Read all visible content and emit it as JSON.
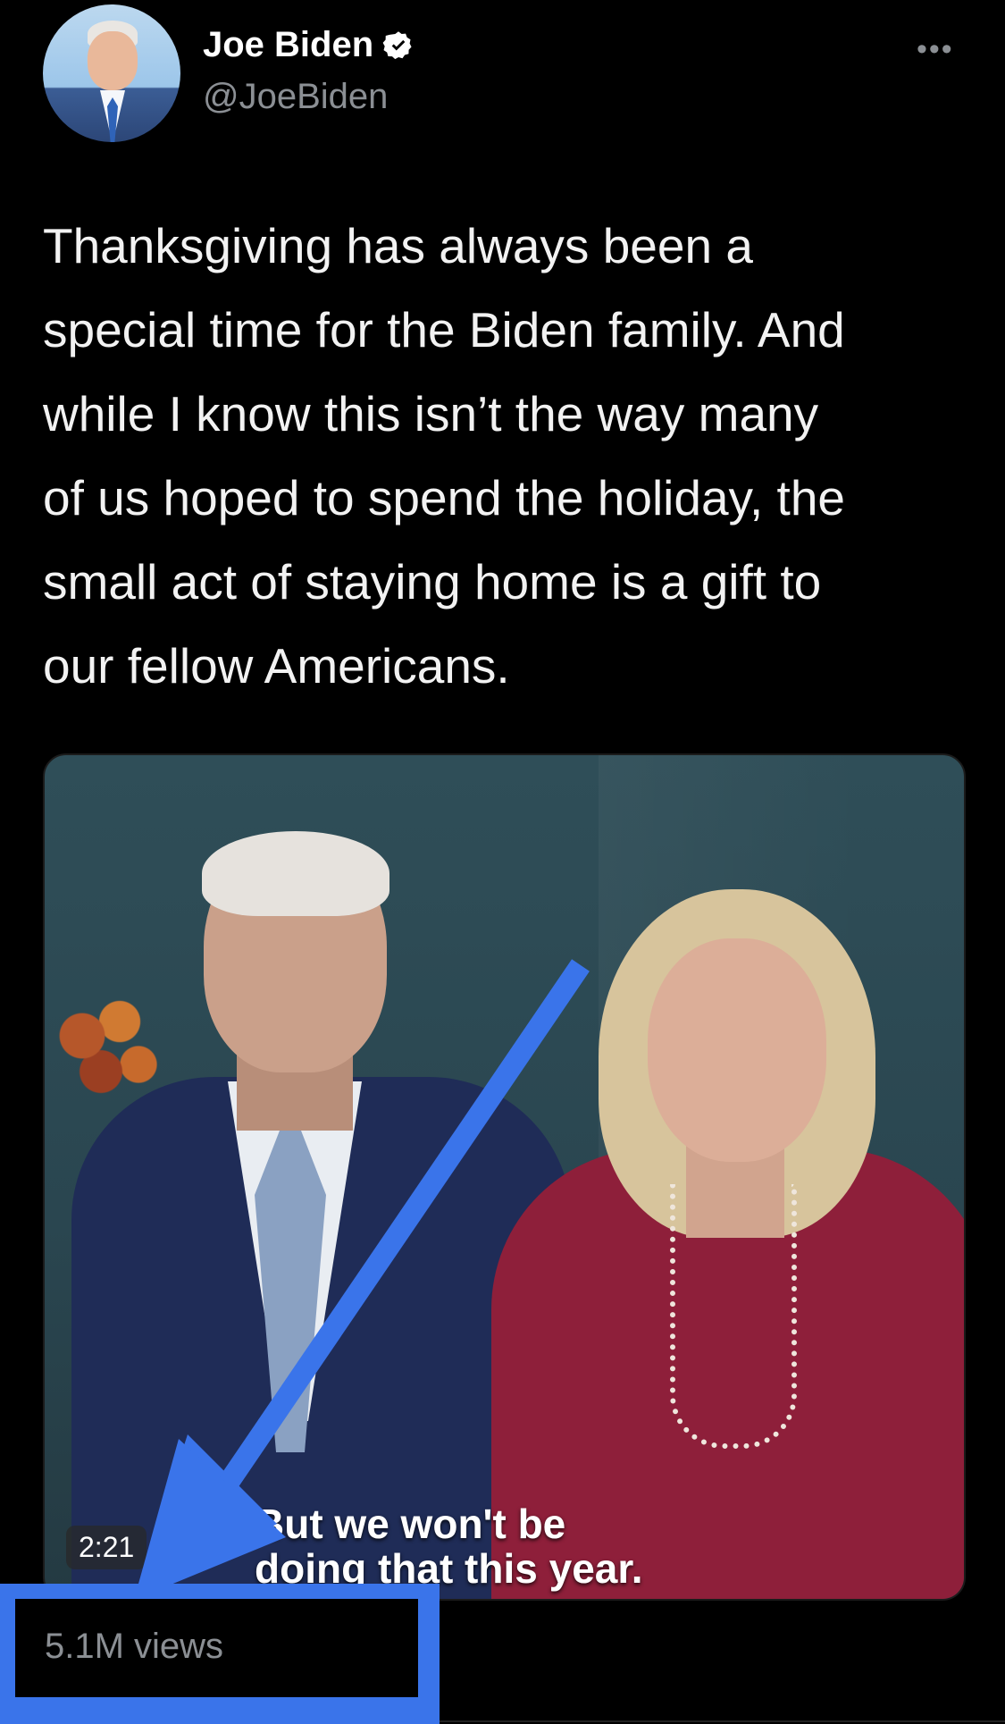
{
  "author": {
    "name": "Joe Biden",
    "handle": "@JoeBiden",
    "verified": true
  },
  "menu_icon": "more-horizontal-icon",
  "tweet": {
    "text": "Thanksgiving has always been a\nspecial time for the Biden family. And\nwhile I know this isn’t the way many\nof us hoped to spend the holiday, the\nsmall act of staying home is a gift to\nour fellow Americans."
  },
  "video": {
    "duration": "2:21",
    "subtitle": "But we won't be\ndoing that this year."
  },
  "stats": {
    "views": "5.1M views"
  },
  "colors": {
    "background": "#000000",
    "secondary_text": "#8b8f94",
    "annotation_blue": "#3a74ea"
  }
}
